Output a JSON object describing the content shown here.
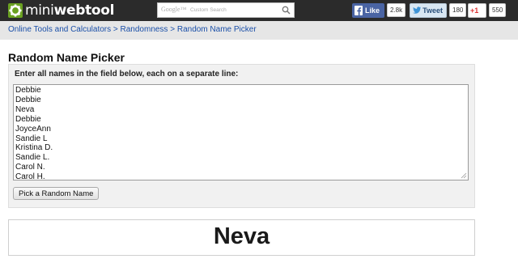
{
  "header": {
    "logo_light": "mini",
    "logo_bold": "webtool",
    "search": {
      "brand": "Google™",
      "placeholder": "Custom Search"
    },
    "social": {
      "facebook_label": "Like",
      "facebook_count": "2.8k",
      "twitter_label": "Tweet",
      "twitter_count": "180",
      "gplus_label": "+1",
      "gplus_count": "550"
    }
  },
  "breadcrumb": {
    "items": [
      "Online Tools and Calculators",
      "Randomness",
      "Random Name Picker"
    ],
    "separator": ">"
  },
  "main": {
    "title": "Random Name Picker",
    "input_label": "Enter all names in the field below, each on a separate line:",
    "names": [
      "Debbie",
      "Debbie",
      "Neva",
      "Debbie",
      "JoyceAnn",
      "Sandie L",
      "Kristina D.",
      "Sandie L.",
      "Carol N.",
      "Carol H."
    ],
    "pick_button": "Pick a Random Name",
    "result": "Neva"
  },
  "colors": {
    "header_bg": "#2b2b2b",
    "breadcrumb_bg": "#e6e6e6",
    "link": "#1a4fa8",
    "facebook": "#4a64a3"
  }
}
